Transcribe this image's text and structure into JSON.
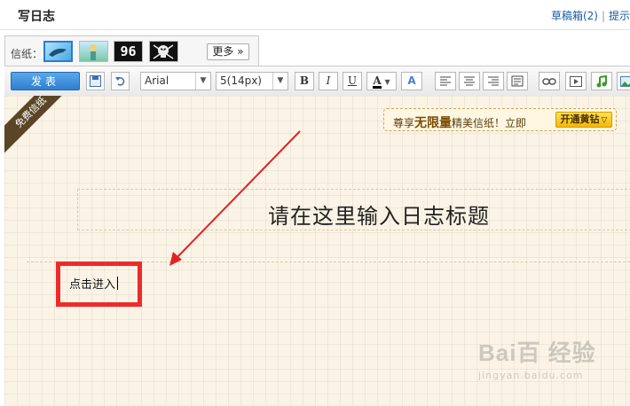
{
  "header": {
    "title": "写日志",
    "drafts_link": "草稿箱(2)",
    "separator": "|",
    "tip_link": "提示"
  },
  "stationery": {
    "label": "信纸：",
    "thumbs": [
      "",
      "",
      "96",
      ""
    ],
    "more_label": "更多 »"
  },
  "toolbar": {
    "publish_label": "发表",
    "font_family": "Arial",
    "font_size": "5(14px)",
    "bold": "B",
    "italic": "I",
    "underline": "U",
    "font_color": "A",
    "text_effect": "A"
  },
  "editor": {
    "free_badge": "免费信纸",
    "promo_text_1": "尊享",
    "promo_text_bold": "无限量",
    "promo_text_2": "精美信纸！立即",
    "promo_button": "开通黄钻",
    "title_placeholder": "请在这里输入日志标题",
    "body_text": "点击进入"
  },
  "watermark": {
    "brand": "Bai百 经验",
    "url": "jingyan.baidu.com"
  },
  "colors": {
    "accent_blue": "#2f7fd0",
    "highlight_red": "#ee2b2b",
    "paper": "#fbf4e6",
    "promo_gold": "#f4b800"
  }
}
